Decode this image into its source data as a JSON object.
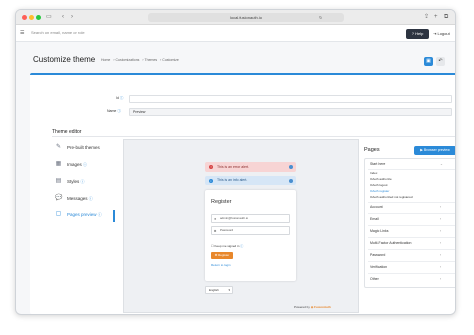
{
  "browser": {
    "url": "local.fusionauth.io"
  },
  "topbar": {
    "search_placeholder": "Search on email, name or role",
    "help_label": "Help",
    "logout_label": "Logout"
  },
  "header": {
    "title": "Customize theme",
    "breadcrumbs": [
      "Home",
      "Customizations",
      "Themes",
      "Customize"
    ]
  },
  "form": {
    "id_label": "Id",
    "id_value": "",
    "name_label": "Name",
    "name_value": "Preview"
  },
  "theme_editor": {
    "title": "Theme editor",
    "sidebar": [
      {
        "label": "Pre-built themes",
        "icon": "brush-icon"
      },
      {
        "label": "Images",
        "icon": "image-icon"
      },
      {
        "label": "Styles",
        "icon": "palette-icon"
      },
      {
        "label": "Messages",
        "icon": "chat-icon"
      },
      {
        "label": "Pages preview",
        "icon": "page-icon"
      }
    ]
  },
  "preview": {
    "error_alert": "This is an error alert.",
    "info_alert": "This is an info alert.",
    "register_title": "Register",
    "email_value": "admin@fusionauth.io",
    "password_value": "Password",
    "keep_signed_in": "Keep me signed in",
    "register_button": "Register",
    "return_link": "Return to login",
    "language": "English",
    "powered_by": "Powered by",
    "brand": "FusionAuth",
    "colors": {
      "error": "#f7d4d4",
      "info": "#d6e6f6",
      "accent": "#e8872b"
    }
  },
  "pages": {
    "title": "Pages",
    "browser_preview_label": "Browser preview",
    "start_here": "Start here",
    "start_items": [
      "Index",
      "OAuth authorize",
      "OAuth logout",
      "OAuth register",
      "OAuth authorized not registered"
    ],
    "groups": [
      "Account",
      "Email",
      "Magic Links",
      "Multi-Factor Authentication",
      "Password",
      "Verification",
      "Other"
    ]
  }
}
